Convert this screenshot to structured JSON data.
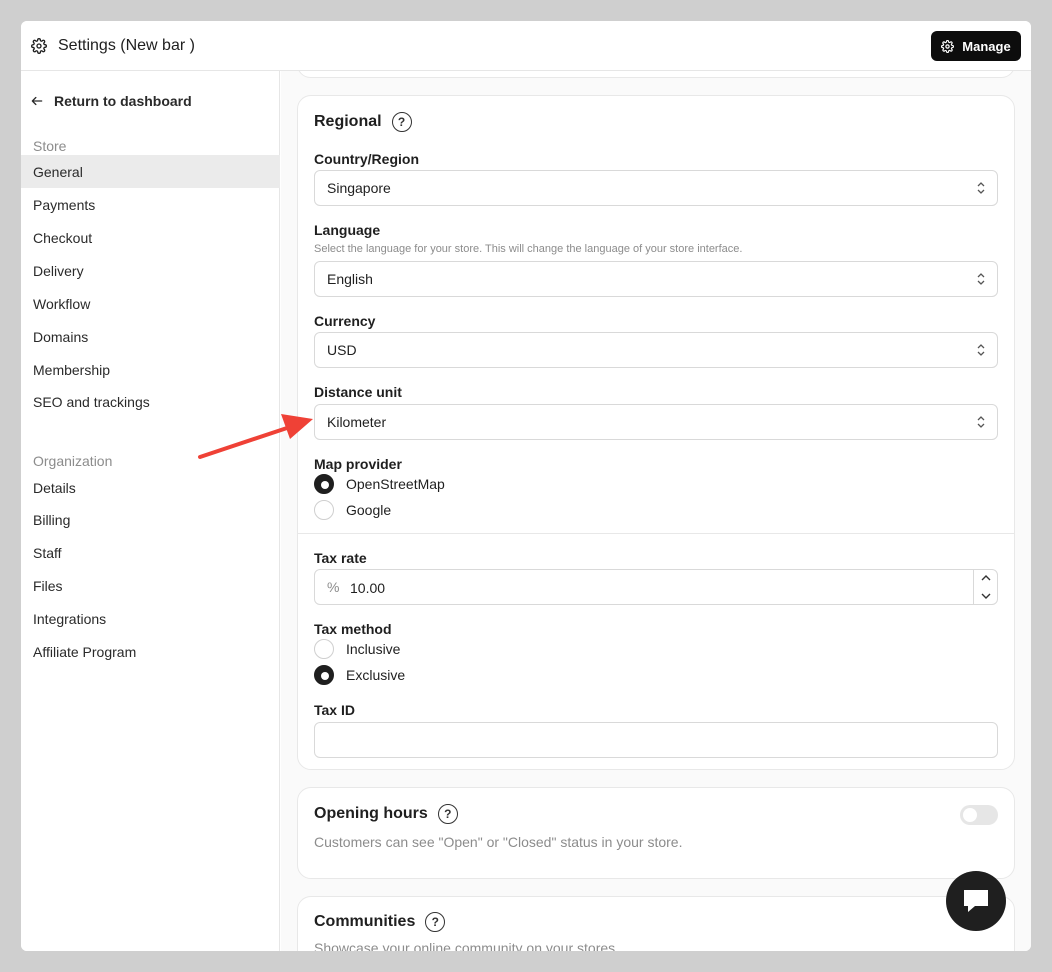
{
  "header": {
    "title": "Settings (New bar )",
    "manage_label": "Manage"
  },
  "sidebar": {
    "back_label": "Return to dashboard",
    "store_label": "Store",
    "store_items": [
      "General",
      "Payments",
      "Checkout",
      "Delivery",
      "Workflow",
      "Domains",
      "Membership",
      "SEO and trackings"
    ],
    "active_item": "General",
    "org_label": "Organization",
    "org_items": [
      "Details",
      "Billing",
      "Staff",
      "Files",
      "Integrations",
      "Affiliate Program"
    ]
  },
  "regional": {
    "title": "Regional",
    "country_label": "Country/Region",
    "country_value": "Singapore",
    "language_label": "Language",
    "language_help": "Select the language for your store. This will change the language of your store interface.",
    "language_value": "English",
    "currency_label": "Currency",
    "currency_value": "USD",
    "distance_label": "Distance unit",
    "distance_value": "Kilometer",
    "map_label": "Map provider",
    "map_options": [
      "OpenStreetMap",
      "Google"
    ],
    "map_selected": "OpenStreetMap",
    "tax_rate_label": "Tax rate",
    "tax_rate_prefix": "%",
    "tax_rate_value": "10.00",
    "tax_method_label": "Tax method",
    "tax_method_options": [
      "Inclusive",
      "Exclusive"
    ],
    "tax_method_selected": "Exclusive",
    "tax_id_label": "Tax ID",
    "tax_id_value": ""
  },
  "opening_hours": {
    "title": "Opening hours",
    "description": "Customers can see \"Open\" or \"Closed\" status in your store.",
    "enabled": false
  },
  "communities": {
    "title": "Communities",
    "description": "Showcase your online community on your stores"
  },
  "colors": {
    "annotation_arrow": "#ef4136",
    "manage_button": "#0d0d0d",
    "active_nav": "#ebebeb"
  }
}
